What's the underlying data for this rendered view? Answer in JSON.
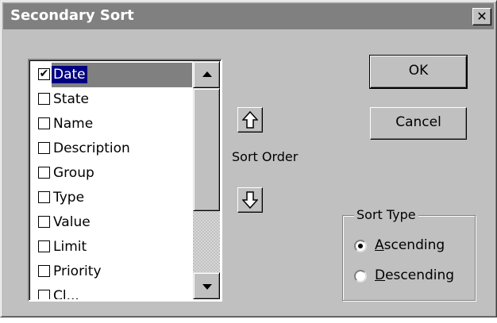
{
  "window": {
    "title": "Secondary Sort",
    "close_glyph": "✕"
  },
  "fields_list": {
    "items": [
      {
        "label": "Date",
        "checked": true,
        "selected": true
      },
      {
        "label": "State",
        "checked": false
      },
      {
        "label": "Name",
        "checked": false
      },
      {
        "label": "Description",
        "checked": false
      },
      {
        "label": "Group",
        "checked": false
      },
      {
        "label": "Type",
        "checked": false
      },
      {
        "label": "Value",
        "checked": false
      },
      {
        "label": "Limit",
        "checked": false
      },
      {
        "label": "Priority",
        "checked": false
      },
      {
        "label": "Cl...",
        "checked": false
      }
    ],
    "check_glyph": "✔"
  },
  "sort_order": {
    "label": "Sort Order",
    "up_icon": "arrow-up-icon",
    "down_icon": "arrow-down-icon"
  },
  "buttons": {
    "ok": "OK",
    "cancel": "Cancel"
  },
  "sort_type": {
    "title": "Sort Type",
    "options": [
      {
        "accel": "A",
        "rest": "scending",
        "selected": true
      },
      {
        "accel": "D",
        "rest": "escending",
        "selected": false
      }
    ]
  },
  "colors": {
    "face": "#c0c0c0",
    "titlebar": "#808080",
    "selection": "#000080"
  }
}
